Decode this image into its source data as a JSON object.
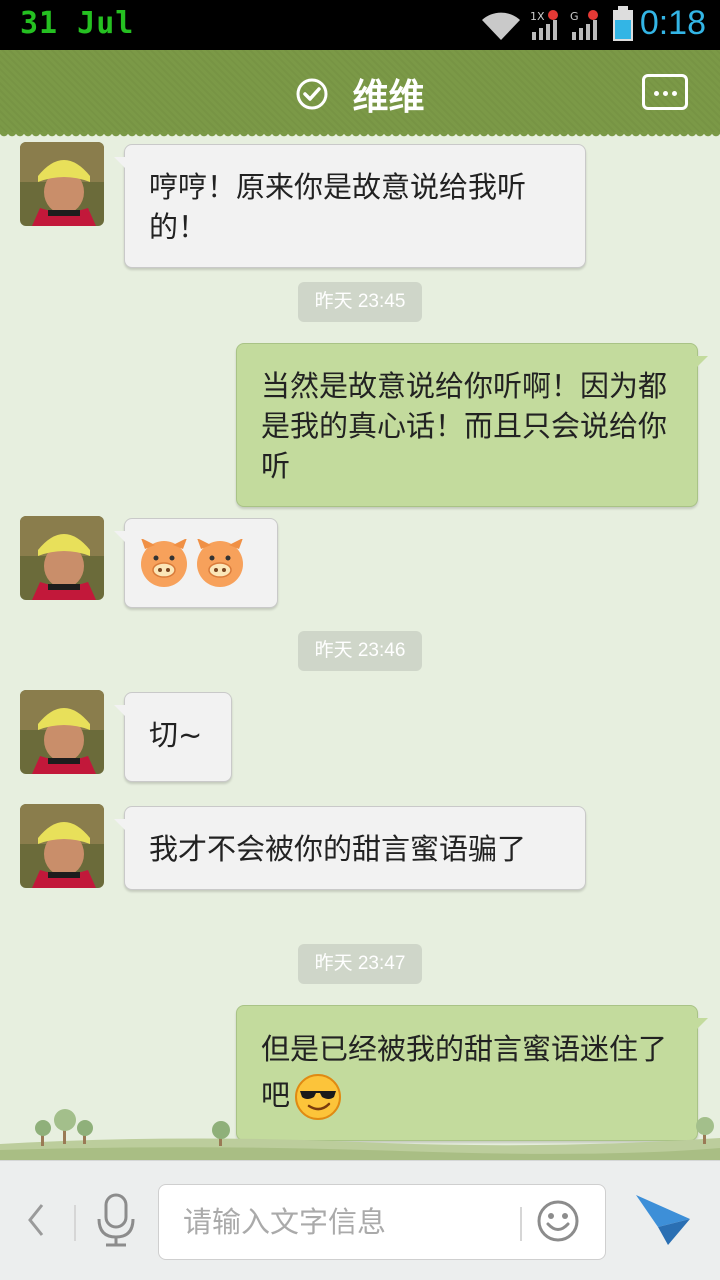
{
  "status_bar": {
    "date": "31 Jul",
    "time": "0:18"
  },
  "header": {
    "title": "维维"
  },
  "messages": [
    {
      "from": "contact",
      "text": "哼哼！原来你是故意说给我听的！"
    },
    {
      "timestamp": "昨天 23:45"
    },
    {
      "from": "me",
      "text": "当然是故意说给你听啊！因为都是我的真心话！而且只会说给你听"
    },
    {
      "from": "contact",
      "stickers": [
        "pig-face-icon",
        "pig-face-icon"
      ]
    },
    {
      "timestamp": "昨天 23:46"
    },
    {
      "from": "contact",
      "text": "切~"
    },
    {
      "from": "contact",
      "text": "我才不会被你的甜言蜜语骗了"
    },
    {
      "timestamp": "昨天 23:47"
    },
    {
      "from": "me",
      "text": "但是已经被我的甜言蜜语迷住了吧",
      "emoji": "sunglasses-smiley-icon"
    }
  ],
  "input_bar": {
    "placeholder": "请输入文字信息"
  },
  "colors": {
    "header": "#7b9947",
    "outgoing_bubble": "#c3db9d",
    "incoming_bubble": "#f2f2f2",
    "chat_background": "#e7efdf",
    "status_icon_blue": "#33b5e5"
  }
}
